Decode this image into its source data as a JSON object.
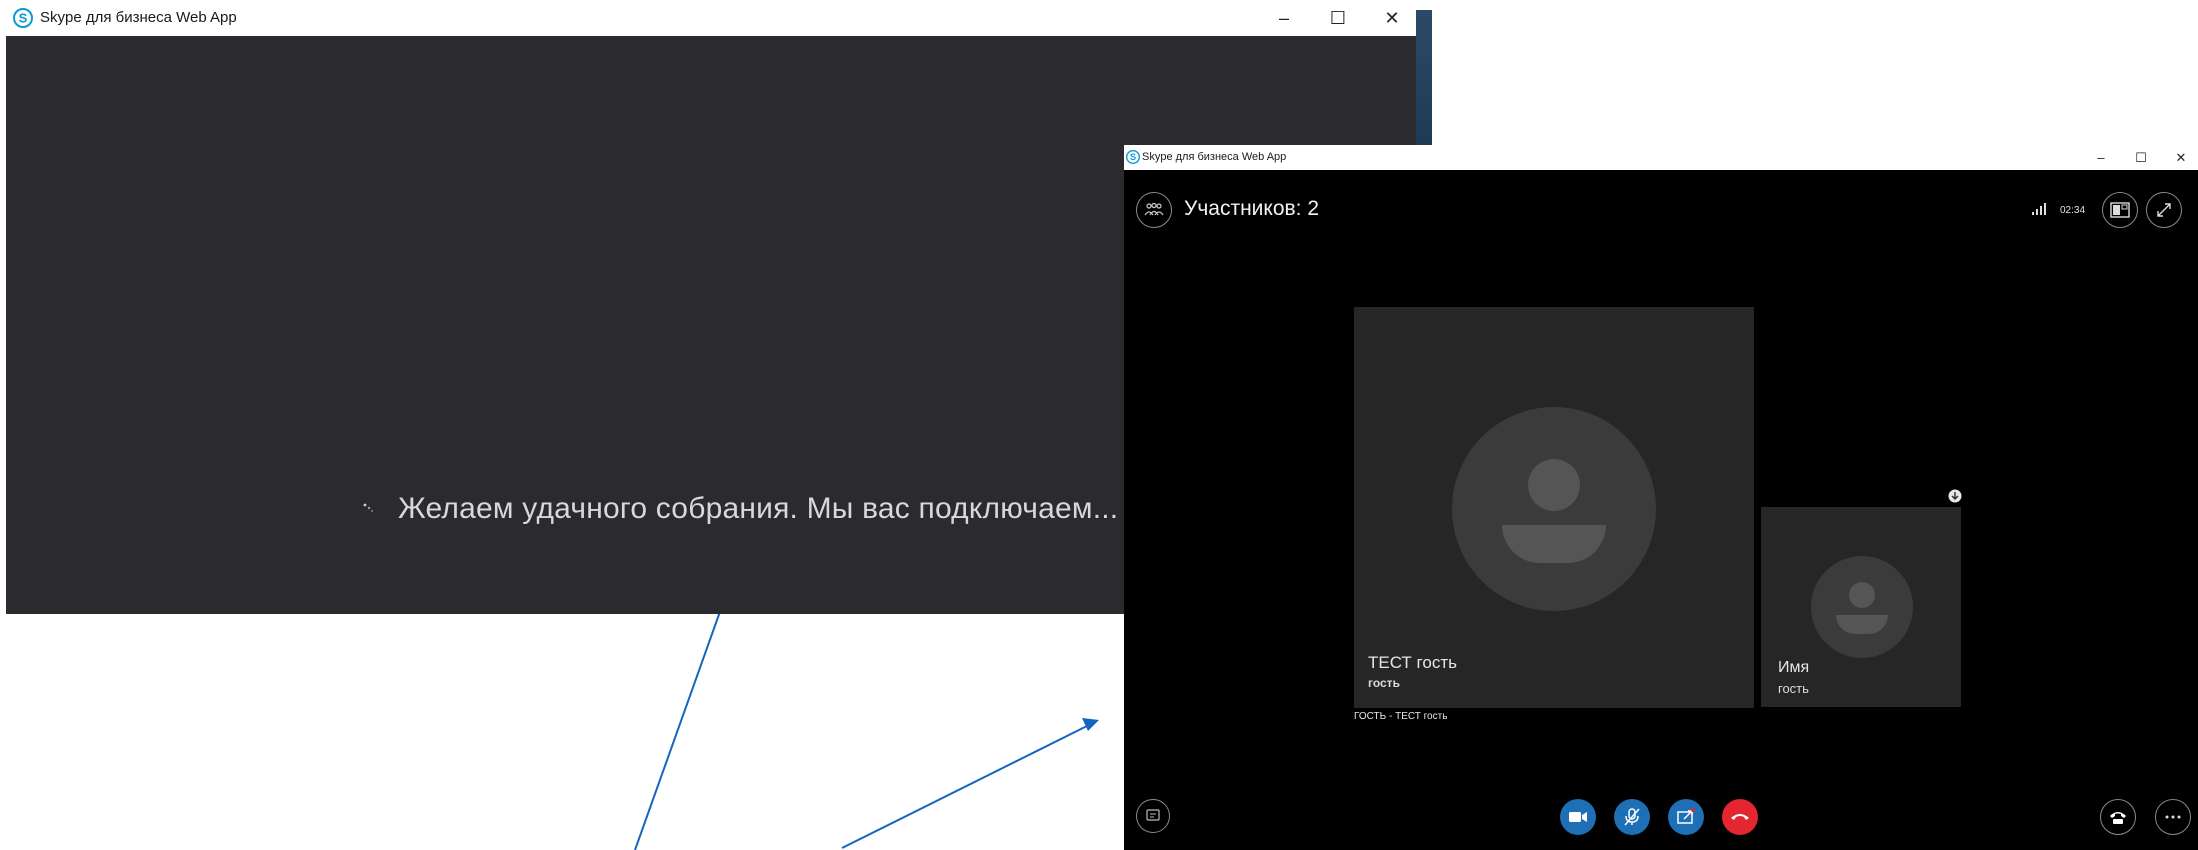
{
  "loading_window": {
    "title": "Skype для бизнеса Web App",
    "controls": {
      "minimize": "–",
      "maximize": "☐",
      "close": "✕"
    },
    "message": "Желаем удачного собрания. Мы вас подключаем..."
  },
  "meeting_window": {
    "title": "Skype для бизнеса Web App",
    "controls": {
      "minimize": "–",
      "maximize": "☐",
      "close": "✕"
    },
    "participants_label": "Участников: 2",
    "timer": "02:34",
    "tiles": [
      {
        "name": "ТЕСТ гость",
        "role": "гость"
      },
      {
        "name": "Имя",
        "role": "гость"
      }
    ],
    "active_speaker_caption": "ГОСТЬ - ТЕСТ гость",
    "colors": {
      "accent": "#1e6fb5",
      "hangup": "#e3262f",
      "tile_bg": "#262626"
    },
    "bottom_controls": {
      "left": [
        "chat-icon"
      ],
      "center": [
        "video-camera-icon",
        "microphone-muted-icon",
        "screen-share-icon",
        "hang-up-icon"
      ],
      "right": [
        "phone-icon",
        "more-options-icon"
      ]
    }
  },
  "annotation_arrow_color": "#1565c0"
}
